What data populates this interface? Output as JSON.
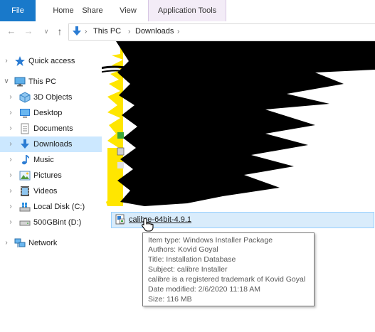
{
  "ribbon": {
    "tabs": [
      {
        "label": "File"
      },
      {
        "label": "Home"
      },
      {
        "label": "Share"
      },
      {
        "label": "View"
      },
      {
        "label": "Application Tools"
      }
    ]
  },
  "address": {
    "breadcrumb": [
      "This PC",
      "Downloads"
    ]
  },
  "sidebar": {
    "items": [
      {
        "label": "Quick access",
        "icon": "star-icon"
      },
      {
        "label": "This PC",
        "icon": "computer-icon"
      },
      {
        "label": "3D Objects",
        "icon": "cube-folder-icon"
      },
      {
        "label": "Desktop",
        "icon": "desktop-folder-icon"
      },
      {
        "label": "Documents",
        "icon": "documents-folder-icon"
      },
      {
        "label": "Downloads",
        "icon": "download-arrow-icon"
      },
      {
        "label": "Music",
        "icon": "music-note-icon"
      },
      {
        "label": "Pictures",
        "icon": "pictures-folder-icon"
      },
      {
        "label": "Videos",
        "icon": "videos-folder-icon"
      },
      {
        "label": "Local Disk (C:)",
        "icon": "windows-drive-icon"
      },
      {
        "label": "500GBint (D:)",
        "icon": "drive-icon"
      },
      {
        "label": "Network",
        "icon": "network-icon"
      }
    ]
  },
  "content": {
    "selected_file": {
      "name": "calibre-64bit-4.9.1",
      "icon": "installer-package-icon"
    }
  },
  "tooltip": {
    "lines": [
      "Item type: Windows Installer Package",
      "Authors: Kovid Goyal",
      "Title: Installation Database",
      "Subject: calibre Installer",
      "calibre is a registered trademark of Kovid Goyal",
      "Date modified: 2/6/2020 11:18 AM",
      "Size: 116 MB"
    ]
  },
  "colors": {
    "file_tab": "#1979ca",
    "selection": "#cce8ff",
    "file_row_highlight": "#d9ecfb",
    "redaction": "#000000",
    "highlighter": "#ffe600"
  }
}
